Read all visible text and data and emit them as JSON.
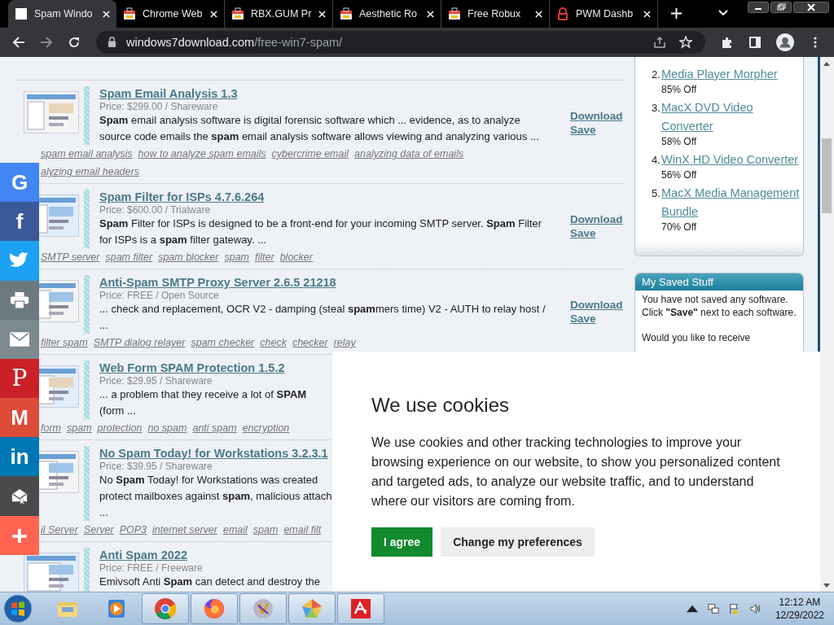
{
  "browser": {
    "tabs": [
      {
        "title": "Spam Windo",
        "kind": "page",
        "selected": true
      },
      {
        "title": "Chrome Web",
        "kind": "store",
        "selected": false
      },
      {
        "title": "RBX.GUM Pr",
        "kind": "store",
        "selected": false
      },
      {
        "title": "Aesthetic Ro",
        "kind": "store",
        "selected": false
      },
      {
        "title": "Free Robux",
        "kind": "store",
        "selected": false
      },
      {
        "title": "PWM Dashb",
        "kind": "lock",
        "selected": false
      }
    ],
    "address": {
      "host": "windows7download.com",
      "path": "/free-win7-spam/"
    }
  },
  "listings": [
    {
      "title": "Spam Email Analysis 1.3",
      "price": "Price: $299.00 / Shareware",
      "lines": [
        "**Spam** email analysis software is digital forensic software which ... evidence, as to analyze",
        "source code emails the **spam** email analysis software allows viewing and analyzing various ..."
      ],
      "links": [
        "Download",
        "Save"
      ],
      "tags": [
        "spam email analysis",
        "how to analyze spam emails",
        "cybercrime email",
        "analyzing data of emails",
        "alyzing email headers"
      ]
    },
    {
      "title": "Spam Filter for ISPs 4.7.6.264",
      "price": "Price: $600.00 / Trialware",
      "lines": [
        "**Spam** Filter for ISPs is designed to be a front-end for your incoming SMTP server. **Spam** Filter",
        "for ISPs is a **spam** filter gateway. ..."
      ],
      "links": [
        "Download",
        "Save"
      ],
      "tags": [
        "SMTP server",
        "spam filter",
        "spam blocker",
        "spam",
        "filter",
        "blocker"
      ]
    },
    {
      "title": "Anti-Spam SMTP Proxy Server 2.6.5 21218",
      "price": "Price: FREE / Open Source",
      "lines": [
        "... check and replacement, OCR V2 - damping (steal **spam**mers time) V2 - AUTH to relay host /",
        "..."
      ],
      "links": [
        "Download",
        "Save"
      ],
      "tags": [
        "filter spam",
        "SMTP dialog relayer",
        "spam checker",
        "check",
        "checker",
        "relay"
      ]
    },
    {
      "title": "Web Form SPAM Protection 1.5.2",
      "price": "Price: $29.95 / Shareware",
      "lines": [
        "... a problem that they receive a lot of **SPAM**",
        "(form ..."
      ],
      "tags": [
        "form",
        "spam",
        "protection",
        "no spam",
        "anti spam",
        "encryption"
      ]
    },
    {
      "title": "No Spam Today! for Workstations 3.2.3.1",
      "price": "Price: $39.95 / Shareware",
      "lines": [
        "No **Spam** Today! for Workstations was created",
        "protect mailboxes against **spam**, malicious attach",
        "..."
      ],
      "tags": [
        "il Server",
        "Server",
        "POP3",
        "internet server",
        "email",
        "spam",
        "email filt"
      ]
    },
    {
      "title": "Anti Spam 2022",
      "price": "Price: FREE / Freeware",
      "lines": [
        "Emivsoft Anti **Spam** can detect and destroy the"
      ]
    }
  ],
  "sidebar": {
    "deals": {
      "items": [
        {
          "num": "2.",
          "name": "Media Player Morpher",
          "discount": "85% Off"
        },
        {
          "num": "3.",
          "name": "MacX DVD Video Converter",
          "discount": "58% Off"
        },
        {
          "num": "4.",
          "name": "WinX HD Video Converter",
          "discount": "56% Off"
        },
        {
          "num": "5.",
          "name": "MacX Media Management Bundle",
          "discount": "70% Off"
        }
      ]
    },
    "saved": {
      "title": "My Saved Stuff",
      "paragraphs": [
        "You have not saved any software. Click **\"Save\"** next to each software.",
        "Would you like to receive"
      ]
    }
  },
  "share_bar": [
    {
      "kind": "google",
      "label": "G"
    },
    {
      "kind": "facebook",
      "label": "f"
    },
    {
      "kind": "twitter"
    },
    {
      "kind": "print"
    },
    {
      "kind": "email"
    },
    {
      "kind": "pinterest",
      "label": "P"
    },
    {
      "kind": "gmail",
      "label": "M"
    },
    {
      "kind": "linkedin",
      "label": "in"
    },
    {
      "kind": "mailer"
    },
    {
      "kind": "more",
      "label": "+"
    }
  ],
  "cookie_notice": {
    "title": "We use cookies",
    "text": "We use cookies and other tracking technologies to improve your browsing experience on our website, to show you personalized content and targeted ads, to analyze our website traffic, and to understand where our visitors are coming from.",
    "buttons": [
      {
        "label": "I agree",
        "kind": "primary"
      },
      {
        "label": "Change my preferences",
        "kind": "secondary"
      }
    ]
  },
  "taskbar": {
    "apps": [
      {
        "kind": "explorer",
        "running": false
      },
      {
        "kind": "media",
        "running": false
      },
      {
        "kind": "chrome",
        "running": true
      },
      {
        "kind": "firefox",
        "running": true
      },
      {
        "kind": "uk",
        "running": true
      },
      {
        "kind": "pentagon",
        "running": true
      },
      {
        "kind": "avira",
        "running": true
      }
    ],
    "clock": {
      "time": "12:12 AM",
      "date": "12/29/2022"
    }
  }
}
